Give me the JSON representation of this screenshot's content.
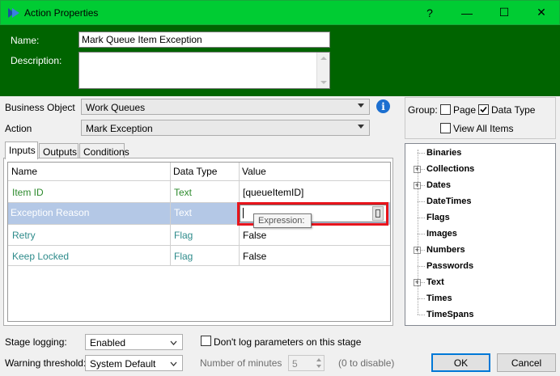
{
  "window": {
    "title": "Action Properties",
    "help_glyph": "?",
    "min_glyph": "—",
    "max_glyph": "☐",
    "close_glyph": "✕"
  },
  "header": {
    "name_label": "Name:",
    "name_value": "Mark Queue Item Exception",
    "description_label": "Description:",
    "description_value": ""
  },
  "form": {
    "business_object_label": "Business Object",
    "business_object_value": "Work Queues",
    "action_label": "Action",
    "action_value": "Mark Exception",
    "info_glyph": "i"
  },
  "group": {
    "label": "Group:",
    "page_label": "Page",
    "page_checked": false,
    "data_type_label": "Data Type",
    "data_type_checked": true,
    "view_all_label": "View All Items",
    "view_all_checked": false
  },
  "tabs": [
    {
      "label": "Inputs",
      "active": true
    },
    {
      "label": "Outputs",
      "active": false
    },
    {
      "label": "Conditions",
      "active": false
    }
  ],
  "grid": {
    "columns": [
      "Name",
      "Data Type",
      "Value"
    ],
    "rows": [
      {
        "name": "Item ID",
        "type": "Text",
        "value": "[queueItemID]"
      },
      {
        "name": "Exception Reason",
        "type": "Text",
        "value": ""
      },
      {
        "name": "Retry",
        "type": "Flag",
        "value": "False"
      },
      {
        "name": "Keep Locked",
        "type": "Flag",
        "value": "False"
      }
    ],
    "tooltip": "Expression:"
  },
  "tree": {
    "items": [
      {
        "label": "Binaries",
        "expandable": false
      },
      {
        "label": "Collections",
        "expandable": true
      },
      {
        "label": "Dates",
        "expandable": true
      },
      {
        "label": "DateTimes",
        "expandable": false
      },
      {
        "label": "Flags",
        "expandable": false
      },
      {
        "label": "Images",
        "expandable": false
      },
      {
        "label": "Numbers",
        "expandable": true
      },
      {
        "label": "Passwords",
        "expandable": false
      },
      {
        "label": "Text",
        "expandable": true
      },
      {
        "label": "Times",
        "expandable": false
      },
      {
        "label": "TimeSpans",
        "expandable": false
      }
    ],
    "expander_glyph": "+"
  },
  "footer": {
    "stage_logging_label": "Stage logging:",
    "stage_logging_value": "Enabled",
    "dont_log_label": "Don't log parameters on this stage",
    "dont_log_checked": false,
    "warning_label": "Warning threshold:",
    "warning_value": "System Default",
    "minutes_label": "Number of minutes",
    "minutes_value": "5",
    "disable_hint": "(0 to disable)",
    "ok_label": "OK",
    "cancel_label": "Cancel"
  },
  "colors": {
    "titlebar": "#00cc33",
    "header": "#006400",
    "row_label_green": "#2e8b2e",
    "row_label_teal": "#2e8b8b",
    "selected_row": "#b4c8e6",
    "highlight_red": "#e8141c",
    "info_blue": "#1c6fd0"
  }
}
